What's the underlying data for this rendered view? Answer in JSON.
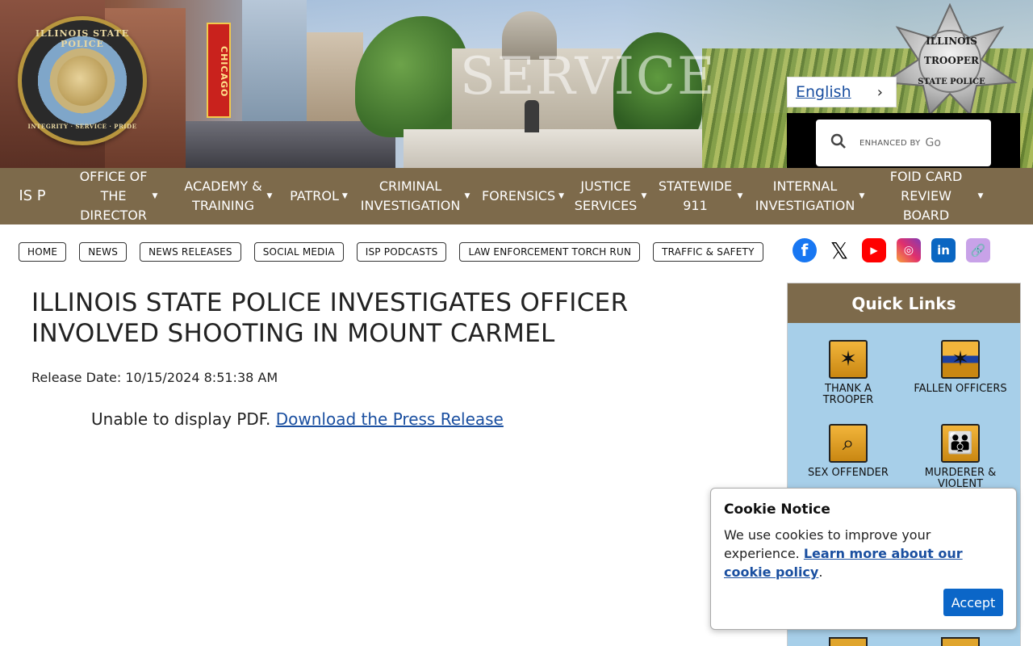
{
  "header": {
    "seal_text": "ILLINOIS STATE POLICE",
    "seal_motto": "INTEGRITY · SERVICE · PRIDE",
    "chicago_sign": "CHICAGO",
    "watermark": "SERVICE",
    "badge_line1": "ILLINOIS",
    "badge_line2": "TROOPER",
    "badge_line3": "STATE POLICE",
    "language": "English",
    "search_enhanced": "ENHANCED BY",
    "search_brand": "Go"
  },
  "nav": {
    "isp": "IS P",
    "items": [
      {
        "label": "OFFICE OF THE DIRECTOR"
      },
      {
        "label": "ACADEMY & TRAINING"
      },
      {
        "label": "PATROL"
      },
      {
        "label": "CRIMINAL INVESTIGATION"
      },
      {
        "label": "FORENSICS"
      },
      {
        "label": "JUSTICE SERVICES"
      },
      {
        "label": "STATEWIDE 911"
      },
      {
        "label": "INTERNAL INVESTIGATION"
      },
      {
        "label": "FOID CARD REVIEW BOARD"
      }
    ]
  },
  "subnav": [
    "HOME",
    "NEWS",
    "NEWS RELEASES",
    "SOCIAL MEDIA",
    "ISP PODCASTS",
    "LAW ENFORCEMENT TORCH RUN",
    "TRAFFIC & SAFETY"
  ],
  "article": {
    "title": "ILLINOIS STATE POLICE INVESTIGATES OFFICER INVOLVED SHOOTING IN MOUNT CARMEL",
    "release_date": "Release Date: 10/15/2024 8:51:38 AM",
    "pdf_message": "Unable to display PDF.",
    "pdf_link": "Download the Press Release"
  },
  "quick_links": {
    "title": "Quick Links",
    "items": [
      {
        "label": "THANK A TROOPER"
      },
      {
        "label": "FALLEN OFFICERS"
      },
      {
        "label": "SEX OFFENDER"
      },
      {
        "label": "MURDERER & VIOLENT"
      }
    ]
  },
  "cookie": {
    "title": "Cookie Notice",
    "text": "We use cookies to improve your experience.",
    "link": "Learn more about our cookie policy",
    "suffix": ".",
    "accept": "Accept"
  },
  "colors": {
    "nav_bg": "#7d6a4b",
    "quick_links_bg": "#a7cfe9",
    "link": "#1a4fa0",
    "accept_button": "#0b66c8"
  }
}
